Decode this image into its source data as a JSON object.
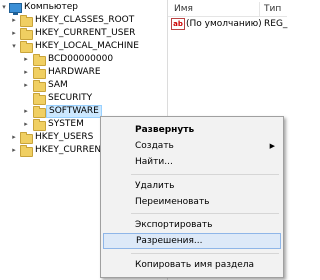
{
  "tree": {
    "root": "Компьютер",
    "items": [
      {
        "label": "HKEY_CLASSES_ROOT"
      },
      {
        "label": "HKEY_CURRENT_USER"
      },
      {
        "label": "HKEY_LOCAL_MACHINE"
      },
      {
        "label": "BCD00000000"
      },
      {
        "label": "HARDWARE"
      },
      {
        "label": "SAM"
      },
      {
        "label": "SECURITY"
      },
      {
        "label": "SOFTWARE"
      },
      {
        "label": "SYSTEM"
      },
      {
        "label": "HKEY_USERS"
      },
      {
        "label": "HKEY_CURREN"
      }
    ]
  },
  "values_pane": {
    "columns": [
      "Имя",
      "Тип"
    ],
    "rows": [
      {
        "name": "(По умолчанию)",
        "type": "REG_"
      }
    ],
    "icon": "ab-string-icon"
  },
  "context_menu": {
    "items": [
      {
        "label": "Развернуть"
      },
      {
        "label": "Создать"
      },
      {
        "label": "Найти..."
      },
      {
        "label": "Удалить"
      },
      {
        "label": "Переименовать"
      },
      {
        "label": "Экспортировать"
      },
      {
        "label": "Разрешения..."
      },
      {
        "label": "Копировать имя раздела"
      }
    ]
  },
  "colors": {
    "selection": "#cce8ff",
    "menu_highlight": "#dde9f8",
    "folder": "#f0cf62"
  }
}
